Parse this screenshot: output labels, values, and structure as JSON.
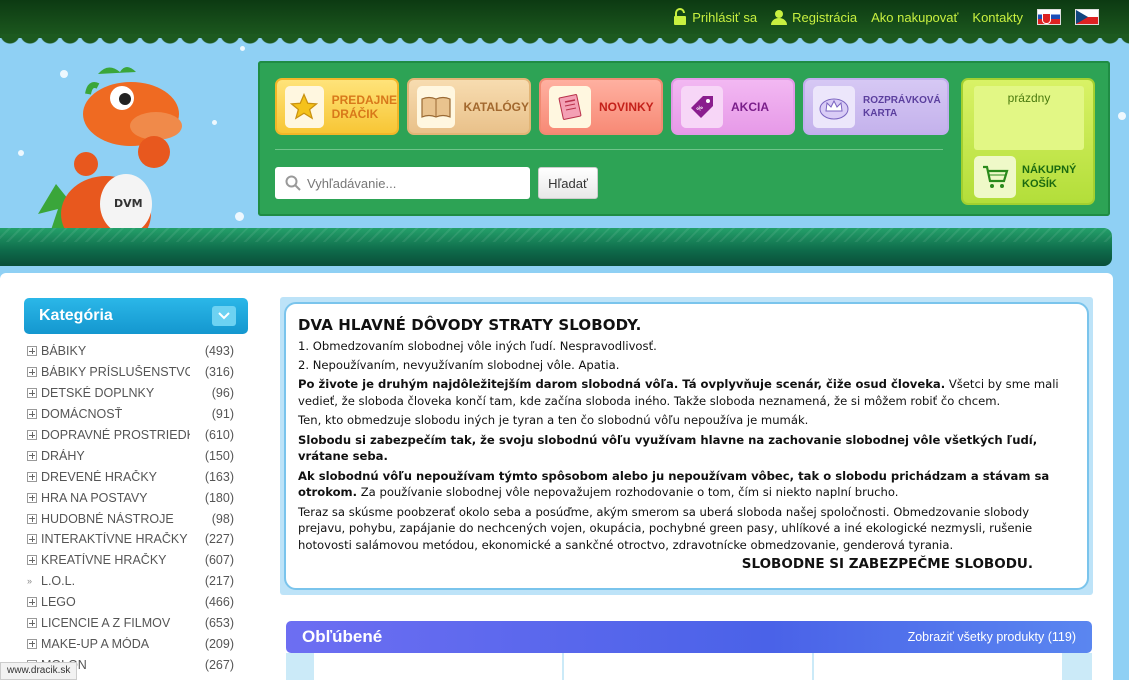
{
  "topnav": {
    "login": "Prihlásiť sa",
    "register": "Registrácia",
    "how_to_buy": "Ako nakupovať",
    "contacts": "Kontakty",
    "flags": [
      "sk-flag",
      "cz-flag"
    ]
  },
  "nav": {
    "buttons": [
      {
        "label": "PREDAJNE DRÁČIK",
        "line1": "PREDAJNE",
        "line2": "DRÁČIK",
        "icon": "star-icon"
      },
      {
        "label": "KATALÓGY",
        "icon": "book-icon"
      },
      {
        "label": "NOVINKY",
        "icon": "newspaper-icon"
      },
      {
        "label": "AKCIA",
        "icon": "price-tag-icon"
      },
      {
        "label": "ROZPRÁVKOVÁ KARTA",
        "line1": "ROZPRÁVKOVÁ",
        "line2": "KARTA",
        "icon": "crown-card-icon"
      }
    ]
  },
  "search": {
    "placeholder": "Vyhľadávanie...",
    "button": "Hľadať"
  },
  "cart": {
    "status": "prázdny",
    "line1": "NÁKUPNÝ",
    "line2": "KOŠÍK"
  },
  "categories": {
    "title": "Kategória",
    "items": [
      {
        "name": "BÁBIKY",
        "count": "(493)",
        "type": "expand"
      },
      {
        "name": "BÁBIKY PRÍSLUŠENSTVO",
        "count": "(316)",
        "type": "expand"
      },
      {
        "name": "DETSKÉ DOPLNKY",
        "count": "(96)",
        "type": "expand"
      },
      {
        "name": "DOMÁCNOSŤ",
        "count": "(91)",
        "type": "expand"
      },
      {
        "name": "DOPRAVNÉ PROSTRIEDKY",
        "count": "(610)",
        "type": "expand"
      },
      {
        "name": "DRÁHY",
        "count": "(150)",
        "type": "expand"
      },
      {
        "name": "DREVENÉ HRAČKY",
        "count": "(163)",
        "type": "expand"
      },
      {
        "name": "HRA NA POSTAVY",
        "count": "(180)",
        "type": "expand"
      },
      {
        "name": "HUDOBNÉ NÁSTROJE",
        "count": "(98)",
        "type": "expand"
      },
      {
        "name": "INTERAKTÍVNE HRAČKY",
        "count": "(227)",
        "type": "expand"
      },
      {
        "name": "KREATÍVNE HRAČKY",
        "count": "(607)",
        "type": "expand"
      },
      {
        "name": "L.O.L.",
        "count": "(217)",
        "type": "arrow"
      },
      {
        "name": "LEGO",
        "count": "(466)",
        "type": "expand"
      },
      {
        "name": "LICENCIE A Z FILMOV",
        "count": "(653)",
        "type": "expand"
      },
      {
        "name": "MAKE-UP A MÓDA",
        "count": "(209)",
        "type": "expand"
      },
      {
        "name": "MOLON",
        "count": "(267)",
        "type": "expand"
      }
    ]
  },
  "notice": {
    "title": "DVA HLAVNÉ DÔVODY STRATY SLOBODY.",
    "point1": "1. Obmedzovaním slobodnej vôle iných ľudí. Nespravodlivosť.",
    "point2": "2. Nepoužívaním, nevyužívaním slobodnej vôle. Apatia.",
    "p1_bold": "Po živote je druhým najdôležitejším darom slobodná vôľa. Tá ovplyvňuje scenár, čiže osud človeka.",
    "p1_rest": " Všetci by sme mali vedieť, že sloboda človeka končí tam, kde začína sloboda iného. Takže sloboda neznamená, že si môžem robiť čo chcem.",
    "p2": "Ten, kto obmedzuje slobodu iných je tyran a ten čo slobodnú vôľu nepoužíva je mumák.",
    "p3_bold": "Slobodu si zabezpečím tak, že svoju slobodnú vôľu využívam hlavne na zachovanie slobodnej vôle všetkých ľudí, vrátane seba.",
    "p4_bold": "Ak slobodnú vôľu nepoužívam týmto spôsobom alebo ju nepoužívam vôbec, tak o slobodu prichádzam a stávam sa otrokom.",
    "p4_rest": " Za používanie slobodnej vôle nepovažujem rozhodovanie o tom, čím si niekto naplní brucho.",
    "p5": "Teraz sa skúsme poobzerať okolo seba a posúďme, akým smerom sa uberá sloboda našej spoločnosti. Obmedzovanie slobody prejavu, pohybu, zapájanie do nechcených vojen, okupácia, pochybné green pasy, uhlíkové a iné ekologické nezmysli, rušenie hotovosti salámovou metódou, ekonomické a sankčné otroctvo, zdravotnícke obmedzovanie, genderová tyrania.",
    "closing": "SLOBODNE SI ZABEZPEČME SLOBODU."
  },
  "favorites": {
    "title": "Obľúbené",
    "show_all": "Zobraziť všetky produkty (119)"
  },
  "status_url": "www.dracik.sk",
  "colors": {
    "sky": "#8fd0f4",
    "header_green": "#2da355",
    "topnav_link": "#c8f040",
    "category_blue": "#1497cf",
    "favorites_purple": "#4a62e8"
  }
}
